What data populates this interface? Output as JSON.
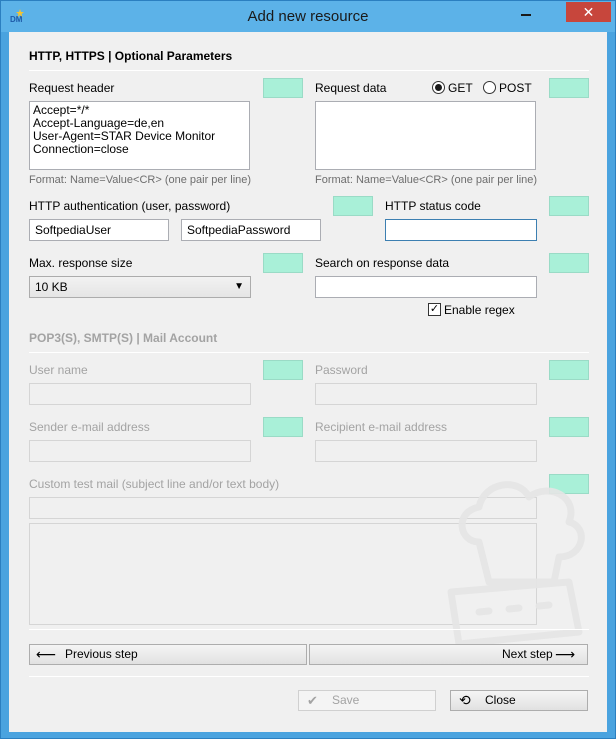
{
  "window": {
    "title": "Add new resource",
    "app_icon": "sdm-logo-icon",
    "close_glyph": "✕"
  },
  "http": {
    "section_title": "HTTP, HTTPS | Optional Parameters",
    "request_header_label": "Request header",
    "request_header_value": "Accept=*/*\nAccept-Language=de,en\nUser-Agent=STAR Device Monitor\nConnection=close",
    "request_header_hint": "Format: Name=Value<CR> (one pair per line)",
    "request_data_label": "Request data",
    "request_data_value": "",
    "request_data_hint": "Format: Name=Value<CR> (one pair per line)",
    "method_get_label": "GET",
    "method_post_label": "POST",
    "method_selected": "GET",
    "auth_label": "HTTP authentication (user, password)",
    "auth_user": "SoftpediaUser",
    "auth_password": "SoftpediaPassword",
    "status_code_label": "HTTP status code",
    "status_code_value": "",
    "max_response_label": "Max. response size",
    "max_response_value": "10 KB",
    "search_label": "Search on response data",
    "search_value": "",
    "regex_label": "Enable regex",
    "regex_checked": true
  },
  "mail": {
    "section_title": "POP3(S), SMTP(S) | Mail Account",
    "user_label": "User name",
    "password_label": "Password",
    "sender_label": "Sender e-mail address",
    "recipient_label": "Recipient e-mail address",
    "custom_label": "Custom test mail (subject line and/or text body)"
  },
  "nav": {
    "prev_label": "Previous step",
    "next_label": "Next step",
    "save_label": "Save",
    "close_label": "Close"
  },
  "colors": {
    "swatch": "#a9f0d8",
    "titlebar": "#5cb2e8",
    "close_button": "#c7463c"
  }
}
